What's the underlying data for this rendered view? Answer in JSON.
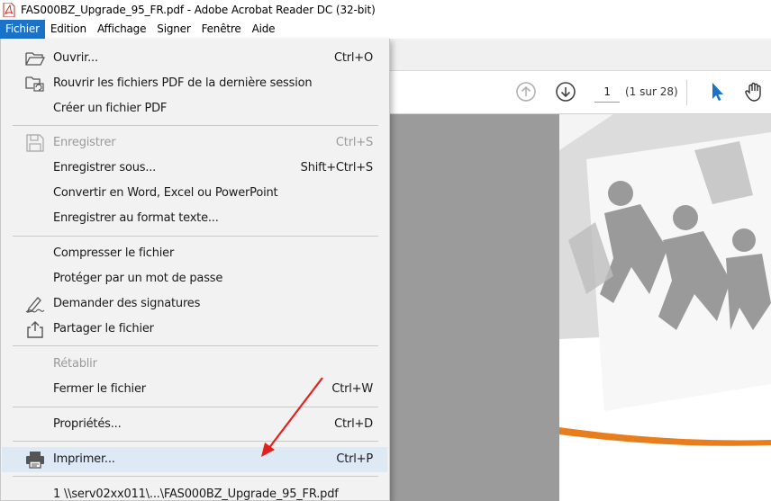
{
  "window": {
    "title": "FAS000BZ_Upgrade_95_FR.pdf - Adobe Acrobat Reader DC (32-bit)"
  },
  "menubar": {
    "items": [
      {
        "label": "Fichier"
      },
      {
        "label": "Edition"
      },
      {
        "label": "Affichage"
      },
      {
        "label": "Signer"
      },
      {
        "label": "Fenêtre"
      },
      {
        "label": "Aide"
      }
    ]
  },
  "toolbar": {
    "page_current": "1",
    "page_total": "(1 sur 28)"
  },
  "file_menu": {
    "open": {
      "label": "Ouvrir...",
      "shortcut": "Ctrl+O"
    },
    "reopen": {
      "label": "Rouvrir les fichiers PDF de la dernière session"
    },
    "create": {
      "label": "Créer un fichier PDF"
    },
    "save": {
      "label": "Enregistrer",
      "shortcut": "Ctrl+S"
    },
    "save_as": {
      "label": "Enregistrer sous...",
      "shortcut": "Shift+Ctrl+S"
    },
    "convert": {
      "label": "Convertir en Word, Excel ou PowerPoint"
    },
    "save_text": {
      "label": "Enregistrer au format texte..."
    },
    "compress": {
      "label": "Compresser le fichier"
    },
    "protect": {
      "label": "Protéger par un mot de passe"
    },
    "signatures": {
      "label": "Demander des signatures"
    },
    "share": {
      "label": "Partager le fichier"
    },
    "revert": {
      "label": "Rétablir"
    },
    "close": {
      "label": "Fermer le fichier",
      "shortcut": "Ctrl+W"
    },
    "properties": {
      "label": "Propriétés...",
      "shortcut": "Ctrl+D"
    },
    "print": {
      "label": "Imprimer...",
      "shortcut": "Ctrl+P"
    },
    "recent": {
      "label": "1 \\\\serv02xx011\\...\\FAS000BZ_Upgrade_95_FR.pdf"
    }
  },
  "colors": {
    "menu_active": "#1a73c9",
    "menu_hover": "#dde9f5",
    "annotation_arrow": "#e3201b",
    "select_tool": "#1a73c9"
  }
}
